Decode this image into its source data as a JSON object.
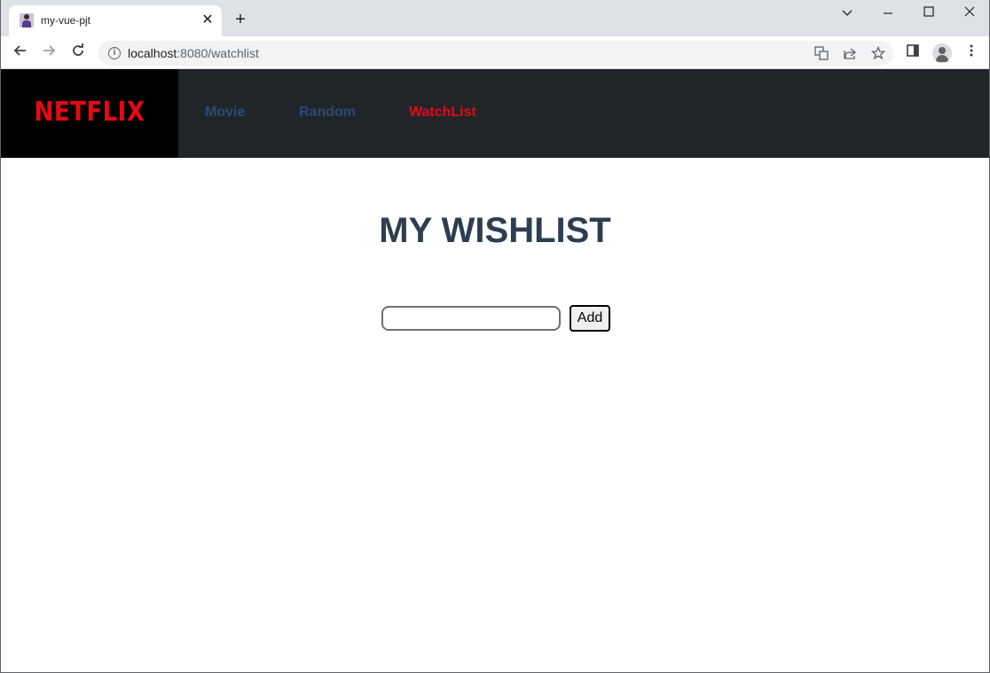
{
  "browser": {
    "tab": {
      "title": "my-vue-pjt",
      "close_icon": "close-icon"
    },
    "new_tab_icon": "plus-icon",
    "window_controls": [
      "chevron-down-icon",
      "minimize-icon",
      "maximize-icon",
      "close-icon"
    ],
    "nav": {
      "back": "arrow-left-icon",
      "forward": "arrow-right-icon",
      "reload": "reload-icon"
    },
    "address": {
      "host": "localhost",
      "rest": ":8080/watchlist"
    },
    "omnibox_icons": [
      "translate-icon",
      "share-icon",
      "star-icon"
    ],
    "toolbar_icons": [
      "side-panel-icon",
      "profile-icon",
      "more-vert-icon"
    ]
  },
  "site": {
    "logo": "NETFLIX",
    "nav_links": [
      {
        "label": "Movie",
        "active": false
      },
      {
        "label": "Random",
        "active": false
      },
      {
        "label": "WatchList",
        "active": true
      }
    ],
    "colors": {
      "brand_red": "#e50914",
      "nav_bg": "#212529",
      "logo_bg": "#000000",
      "title": "#2c3e50"
    }
  },
  "main": {
    "title": "MY WISHLIST",
    "input": {
      "value": "",
      "placeholder": ""
    },
    "add_label": "Add"
  }
}
